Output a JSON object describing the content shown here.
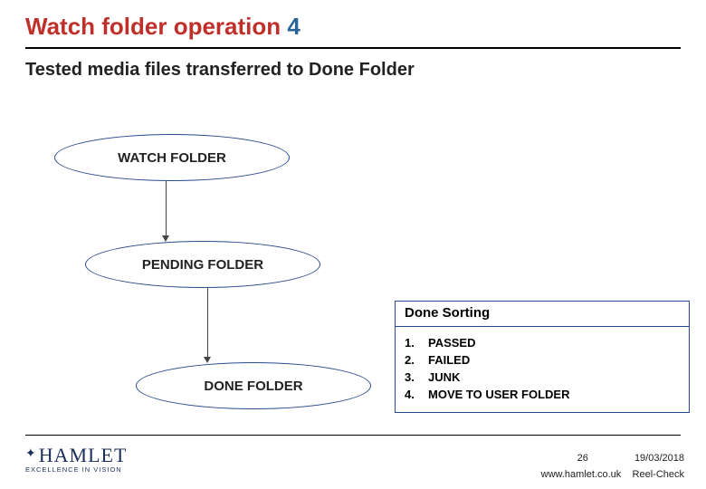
{
  "title": {
    "red_part": "Watch folder operation",
    "blue_part": "4"
  },
  "subtitle": "Tested media files transferred to Done Folder",
  "nodes": {
    "watch": "WATCH FOLDER",
    "pending": "PENDING FOLDER",
    "done": "DONE FOLDER"
  },
  "sorting": {
    "header": "Done Sorting",
    "items": [
      {
        "num": "1.",
        "label": "PASSED"
      },
      {
        "num": "2.",
        "label": "FAILED"
      },
      {
        "num": "3.",
        "label": "JUNK"
      },
      {
        "num": "4.",
        "label": "MOVE TO USER FOLDER"
      }
    ]
  },
  "brand": {
    "name": "HAMLET",
    "tagline": "EXCELLENCE IN VISION"
  },
  "footer": {
    "page": "26",
    "date": "19/03/2018",
    "site": "www.hamlet.co.uk",
    "product": "Reel-Check"
  }
}
